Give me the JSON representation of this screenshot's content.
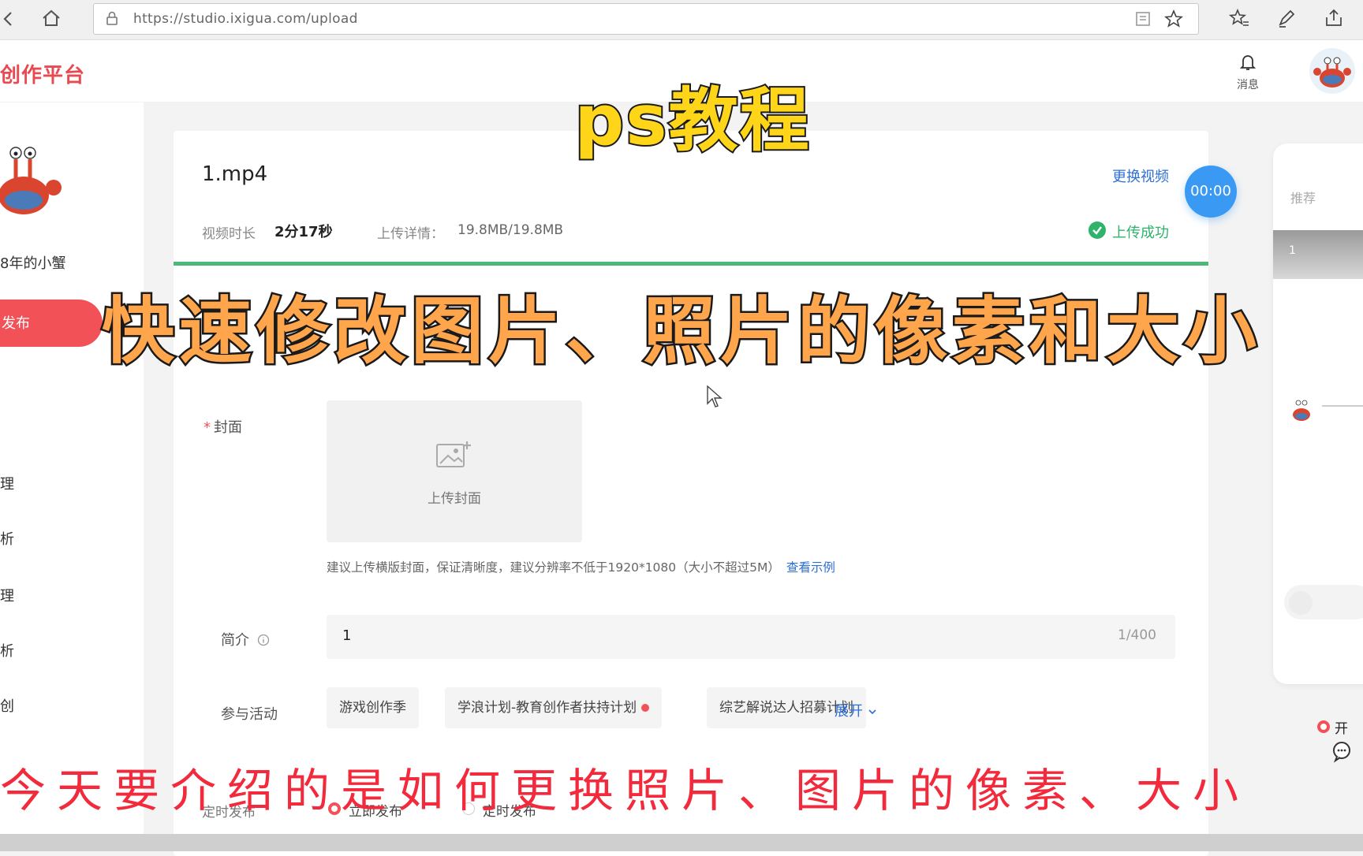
{
  "browser": {
    "url": "https://studio.ixigua.com/upload"
  },
  "header": {
    "brand": "创作平台",
    "notification_label": "消息"
  },
  "sidebar": {
    "username": "8年的小蟹",
    "publish_label": "发布",
    "items": [
      "理",
      "析",
      "理",
      "析",
      "创"
    ]
  },
  "upload": {
    "file_name": "1.mp4",
    "replace_label": "更换视频",
    "timer": "00:00",
    "duration_label": "视频时长",
    "duration_value": "2分17秒",
    "size_label": "上传详情：",
    "size_value": "19.8MB/19.8MB",
    "status": "上传成功",
    "progress": 1.0
  },
  "form": {
    "cover_label": "封面",
    "cover_required": "*",
    "cover_upload": "上传封面",
    "cover_hint": "建议上传横版封面，保证清晰度，建议分辨率不低于1920*1080（大小不超过5M）",
    "cover_hint_link": "查看示例",
    "intro_label": "简介",
    "intro_value": "1",
    "intro_counter": "1/400",
    "activity_label": "参与活动",
    "activities": [
      "游戏创作季",
      "学浪计划-教育创作者扶持计划",
      "综艺解说达人招募计划"
    ],
    "expand_label": "展开",
    "schedule_label": "定时发布",
    "schedule_now": "立即发布",
    "schedule_later": "定时发布"
  },
  "preview": {
    "tab": "推荐",
    "video_num": "1"
  },
  "float_tip": "开",
  "captions": {
    "top": "ps教程",
    "middle": "快速修改图片、照片的像素和大小",
    "bottom": "今天要介绍的是如何更换照片、图片的像素、大小"
  },
  "colors": {
    "brand": "#e84a52",
    "accent": "#f25257",
    "link": "#2e6fd8",
    "success": "#2fb36b",
    "caption_top": "#ffd51a",
    "caption_mid": "#ffa64d",
    "caption_bottom": "#f22a3c"
  }
}
